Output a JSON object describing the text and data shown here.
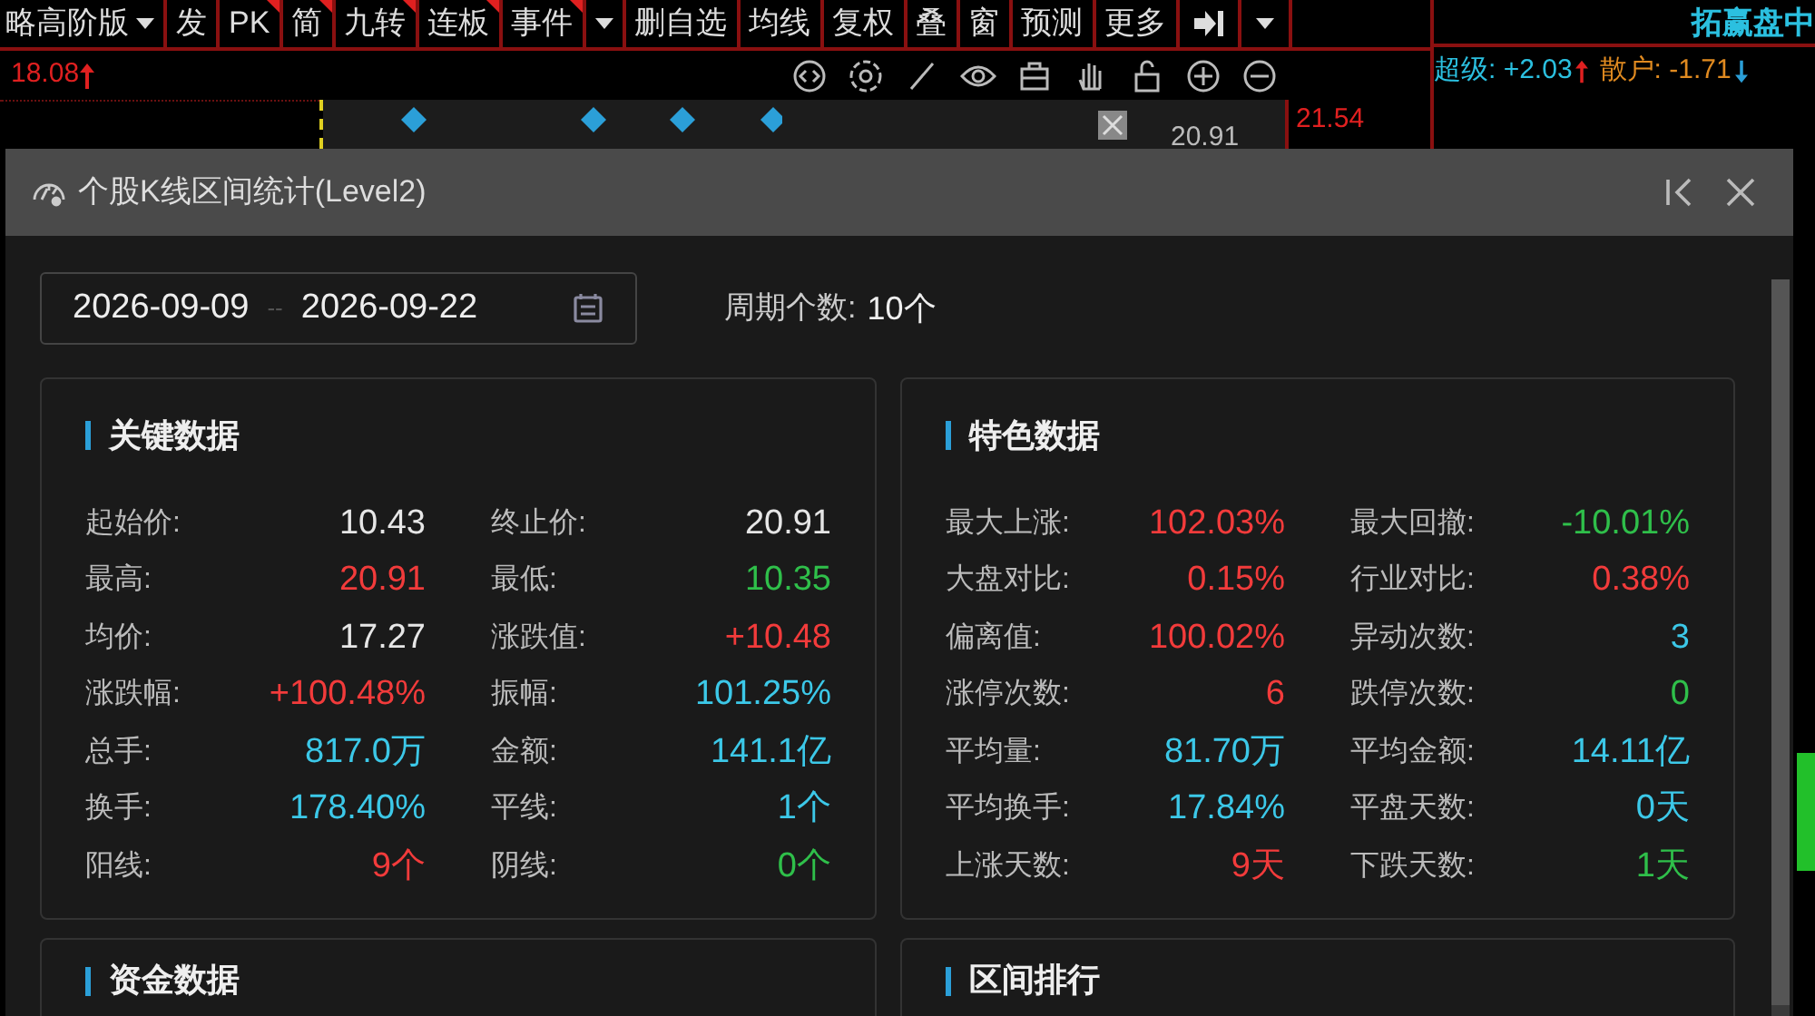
{
  "toolbar": {
    "items": [
      {
        "label": "略高阶版",
        "caret": true,
        "marked": false
      },
      {
        "label": "发",
        "caret": false,
        "marked": false
      },
      {
        "label": "PK",
        "caret": false,
        "marked": true
      },
      {
        "label": "简",
        "caret": false,
        "marked": true
      },
      {
        "label": "九转",
        "caret": false,
        "marked": true
      },
      {
        "label": "连板",
        "caret": false,
        "marked": true
      },
      {
        "label": "事件",
        "caret": false,
        "marked": true
      },
      {
        "caret": true,
        "marked": false
      },
      {
        "label": "删自选",
        "caret": false,
        "marked": false
      },
      {
        "label": "均线",
        "caret": false,
        "marked": false
      },
      {
        "label": "复权",
        "caret": false,
        "marked": false
      },
      {
        "label": "叠",
        "caret": false,
        "marked": false
      },
      {
        "label": "窗",
        "caret": false,
        "marked": false
      },
      {
        "label": "预测",
        "caret": false,
        "marked": false
      },
      {
        "label": "更多",
        "caret": false,
        "marked": false
      }
    ]
  },
  "chart": {
    "price": "18.08",
    "high_label": "21.54",
    "close_label": "20.91"
  },
  "side_panel": {
    "title": "拓赢盘中",
    "super": "超级: +2.03",
    "retail": "散户: -1.71"
  },
  "dialog": {
    "title": "个股K线区间统计(Level2)",
    "date_range": {
      "start": "2026-09-09",
      "separator": "--",
      "end": "2026-09-22"
    },
    "period": {
      "label": "周期个数:",
      "value": "10个"
    },
    "cards": [
      {
        "title": "关键数据",
        "rows": [
          {
            "label": "起始价:",
            "value": "10.43",
            "color": "#e6e6e6"
          },
          {
            "label": "终止价:",
            "value": "20.91",
            "color": "#e6e6e6"
          },
          {
            "label": "最高:",
            "value": "20.91",
            "color": "#f23b3b"
          },
          {
            "label": "最低:",
            "value": "10.35",
            "color": "#2fbf4a"
          },
          {
            "label": "均价:",
            "value": "17.27",
            "color": "#e6e6e6"
          },
          {
            "label": "涨跌值:",
            "value": "+10.48",
            "color": "#f23b3b"
          },
          {
            "label": "涨跌幅:",
            "value": "+100.48%",
            "color": "#f23b3b"
          },
          {
            "label": "振幅:",
            "value": "101.25%",
            "color": "#3cc8e8"
          },
          {
            "label": "总手:",
            "value": "817.0万",
            "color": "#3cc8e8"
          },
          {
            "label": "金额:",
            "value": "141.1亿",
            "color": "#3cc8e8"
          },
          {
            "label": "换手:",
            "value": "178.40%",
            "color": "#3cc8e8"
          },
          {
            "label": "平线:",
            "value": "1个",
            "color": "#3cc8e8"
          },
          {
            "label": "阳线:",
            "value": "9个",
            "color": "#f23b3b"
          },
          {
            "label": "阴线:",
            "value": "0个",
            "color": "#2fbf4a"
          }
        ]
      },
      {
        "title": "特色数据",
        "rows": [
          {
            "label": "最大上涨:",
            "value": "102.03%",
            "color": "#f23b3b"
          },
          {
            "label": "最大回撤:",
            "value": "-10.01%",
            "color": "#2fbf4a"
          },
          {
            "label": "大盘对比:",
            "value": "0.15%",
            "color": "#f23b3b"
          },
          {
            "label": "行业对比:",
            "value": "0.38%",
            "color": "#f23b3b"
          },
          {
            "label": "偏离值:",
            "value": "100.02%",
            "color": "#f23b3b"
          },
          {
            "label": "异动次数:",
            "value": "3",
            "color": "#3cc8e8"
          },
          {
            "label": "涨停次数:",
            "value": "6",
            "color": "#f23b3b"
          },
          {
            "label": "跌停次数:",
            "value": "0",
            "color": "#2fbf4a"
          },
          {
            "label": "平均量:",
            "value": "81.70万",
            "color": "#3cc8e8"
          },
          {
            "label": "平均金额:",
            "value": "14.11亿",
            "color": "#3cc8e8"
          },
          {
            "label": "平均换手:",
            "value": "17.84%",
            "color": "#3cc8e8"
          },
          {
            "label": "平盘天数:",
            "value": "0天",
            "color": "#3cc8e8"
          },
          {
            "label": "上涨天数:",
            "value": "9天",
            "color": "#f23b3b"
          },
          {
            "label": "下跌天数:",
            "value": "1天",
            "color": "#2fbf4a"
          }
        ]
      },
      {
        "title": "资金数据"
      },
      {
        "title": "区间排行"
      }
    ]
  }
}
